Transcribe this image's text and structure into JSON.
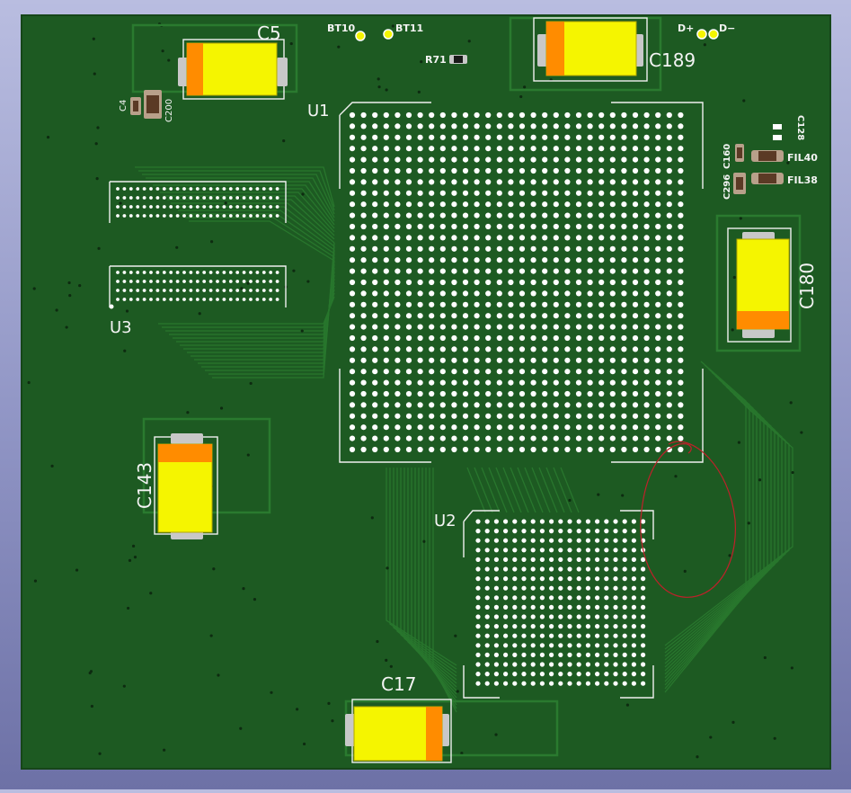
{
  "viewer": {
    "background_top": "#b9bde0",
    "background_bottom": "#6d71a6"
  },
  "board": {
    "soldermask_color": "#1d5a22",
    "copper_color": "#2a7a2f",
    "silkscreen_color": "#f4f4f4",
    "tantalum_body_color": "#f5f500",
    "polarity_band_color": "#ff8c00",
    "annotation_color": "#c0202a"
  },
  "labels": {
    "c5": "C5",
    "c189": "C189",
    "c180": "C180",
    "c143": "C143",
    "c17": "C17",
    "u1": "U1",
    "u2": "U2",
    "u3": "U3",
    "c4": "C4",
    "c200": "C200",
    "bt10": "BT10",
    "bt11": "BT11",
    "r71": "R71",
    "d_plus": "D+",
    "d_minus": "D−",
    "c128": "C128",
    "c160": "C160",
    "c296": "C296",
    "fil40": "FIL40",
    "fil38": "FIL38"
  },
  "annotation": {
    "type": "freehand-ellipse",
    "color": "#c0202a"
  }
}
